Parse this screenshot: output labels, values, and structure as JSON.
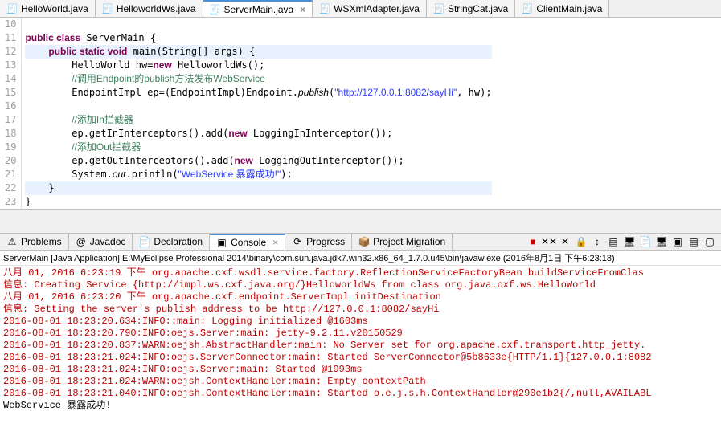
{
  "tabs": [
    {
      "label": "HelloWorld.java"
    },
    {
      "label": "HelloworldWs.java"
    },
    {
      "label": "ServerMain.java",
      "active": true,
      "closable": true
    },
    {
      "label": "WSXmlAdapter.java"
    },
    {
      "label": "StringCat.java"
    },
    {
      "label": "ClientMain.java"
    }
  ],
  "code": {
    "lines": [
      {
        "n": "10",
        "t": ""
      },
      {
        "n": "11",
        "t": "<kw>public class</kw> ServerMain {"
      },
      {
        "n": "12",
        "hl": true,
        "t": "    <kw>public static void</kw> main(String[] args) {"
      },
      {
        "n": "13",
        "t": "        HelloWorld hw=<kw>new</kw> HelloworldWs();"
      },
      {
        "n": "14",
        "t": "        <cm>//调用Endpoint的publish方法发布WebService</cm>"
      },
      {
        "n": "15",
        "t": "        EndpointImpl ep=(EndpointImpl)Endpoint.<fn>publish</fn>(<st>\"http://127.0.0.1:8082/sayHi\"</st>, hw);"
      },
      {
        "n": "16",
        "t": ""
      },
      {
        "n": "17",
        "t": "        <cm>//添加In拦截器</cm>"
      },
      {
        "n": "18",
        "t": "        ep.getInInterceptors().add(<kw>new</kw> LoggingInInterceptor());"
      },
      {
        "n": "19",
        "t": "        <cm>//添加Out拦截器</cm>"
      },
      {
        "n": "20",
        "t": "        ep.getOutInterceptors().add(<kw>new</kw> LoggingOutInterceptor());"
      },
      {
        "n": "21",
        "t": "        System.<fn>out</fn>.println(<st>\"WebService 暴露成功!\"</st>);"
      },
      {
        "n": "22",
        "hl": true,
        "t": "    }"
      },
      {
        "n": "23",
        "t": "}"
      }
    ]
  },
  "panels": [
    {
      "label": "Problems",
      "icon": "⚠"
    },
    {
      "label": "Javadoc",
      "icon": "@"
    },
    {
      "label": "Declaration",
      "icon": "📄"
    },
    {
      "label": "Console",
      "icon": "▣",
      "active": true,
      "closable": true
    },
    {
      "label": "Progress",
      "icon": "⟳"
    },
    {
      "label": "Project Migration",
      "icon": "📦"
    }
  ],
  "toolbar_icons": [
    "■",
    "✕✕",
    "✕",
    "🔒",
    "↕",
    "▤",
    "🖥",
    "📄",
    "🖥",
    "▣",
    "▤",
    "▢"
  ],
  "console_info": "ServerMain [Java Application] E:\\MyEclipse Professional 2014\\binary\\com.sun.java.jdk7.win32.x86_64_1.7.0.u45\\bin\\javaw.exe (2016年8月1日 下午6:23:18)",
  "console_lines": [
    {
      "c": "red",
      "t": "八月 01, 2016 6:23:19 下午 org.apache.cxf.wsdl.service.factory.ReflectionServiceFactoryBean buildServiceFromClas"
    },
    {
      "c": "red",
      "t": "信息: Creating Service {http://impl.ws.cxf.java.org/}HelloworldWs from class org.java.cxf.ws.HelloWorld"
    },
    {
      "c": "red",
      "t": "八月 01, 2016 6:23:20 下午 org.apache.cxf.endpoint.ServerImpl initDestination"
    },
    {
      "c": "red",
      "t": "信息: Setting the server's publish address to be http://127.0.0.1:8082/sayHi"
    },
    {
      "c": "red",
      "t": "2016-08-01 18:23:20.634:INFO::main: Logging initialized @1603ms"
    },
    {
      "c": "red",
      "t": "2016-08-01 18:23:20.790:INFO:oejs.Server:main: jetty-9.2.11.v20150529"
    },
    {
      "c": "red",
      "t": "2016-08-01 18:23:20.837:WARN:oejsh.AbstractHandler:main: No Server set for org.apache.cxf.transport.http_jetty."
    },
    {
      "c": "red",
      "t": "2016-08-01 18:23:21.024:INFO:oejs.ServerConnector:main: Started ServerConnector@5b8633e{HTTP/1.1}{127.0.0.1:8082"
    },
    {
      "c": "red",
      "t": "2016-08-01 18:23:21.024:INFO:oejs.Server:main: Started @1993ms"
    },
    {
      "c": "red",
      "t": "2016-08-01 18:23:21.024:WARN:oejsh.ContextHandler:main: Empty contextPath"
    },
    {
      "c": "red",
      "t": "2016-08-01 18:23:21.040:INFO:oejsh.ContextHandler:main: Started o.e.j.s.h.ContextHandler@290e1b2{/,null,AVAILABL"
    },
    {
      "c": "",
      "t": "WebService 暴露成功!"
    }
  ]
}
